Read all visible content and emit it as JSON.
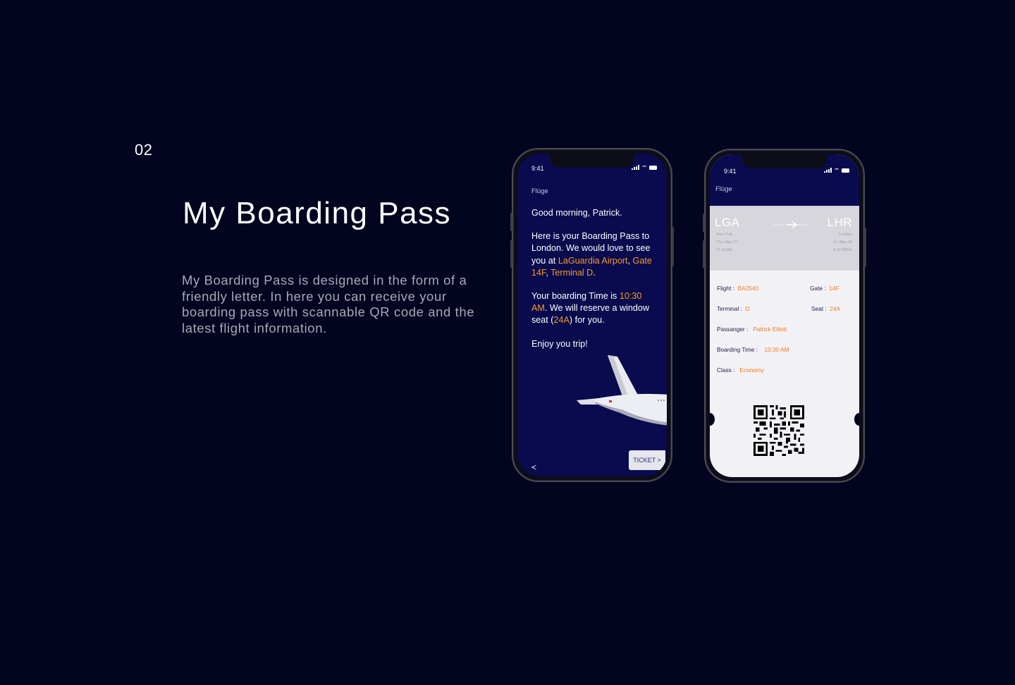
{
  "intro": {
    "number": "02",
    "title": "My Boarding Pass",
    "description": "My Boarding Pass is designed in the form of a friendly letter. In here you can receive your boarding pass with scannable QR code and the latest flight information."
  },
  "letter_screen": {
    "time": "9:41",
    "nav_label": "Flüge",
    "greeting": "Good morning, Patrick.",
    "p2_part1": "Here is your Boarding Pass to London. We would love to see you at ",
    "p2_airport": "LaGuardia Airport",
    "p2_comma": ",",
    "p2_gate": "Gate 14F",
    "p2_comma2": ", ",
    "p2_terminal": "Terminal D",
    "p2_end": ".",
    "p3_part1": "Your boarding Time is ",
    "p3_time": "10:30 AM",
    "p3_part2": ". We will reserve a window seat (",
    "p3_seat": "24A",
    "p3_part3": ") for you.",
    "closing": "Enjoy you trip!",
    "ticket_button": "TICKET >",
    "back_button": "<"
  },
  "ticket_screen": {
    "time": "9:41",
    "nav_label": "Flüge",
    "origin": {
      "code": "LGA",
      "city": "New York",
      "date": "Thu, May 27",
      "time": "11:15 AM"
    },
    "destination": {
      "code": "LHR",
      "city": "London",
      "date": "Fr, May 28",
      "time": "5:22 PM+1"
    },
    "fields": {
      "flight_label": "Flight :",
      "flight_value": "BA2540",
      "gate_label": "Gate :",
      "gate_value": "14F",
      "terminal_label": "Terminal :",
      "terminal_value": "D",
      "seat_label": "Seat :",
      "seat_value": "24A",
      "passenger_label": "Passanger :",
      "passenger_value": "Patrick Elliott",
      "boarding_label": "Boarding Time :",
      "boarding_value": "10:30 AM",
      "class_label": "Class :",
      "class_value": "Economy"
    }
  },
  "colors": {
    "background": "#03041f",
    "screen": "#0a0a4e",
    "accent": "#f39b26",
    "value": "#f0781e"
  }
}
